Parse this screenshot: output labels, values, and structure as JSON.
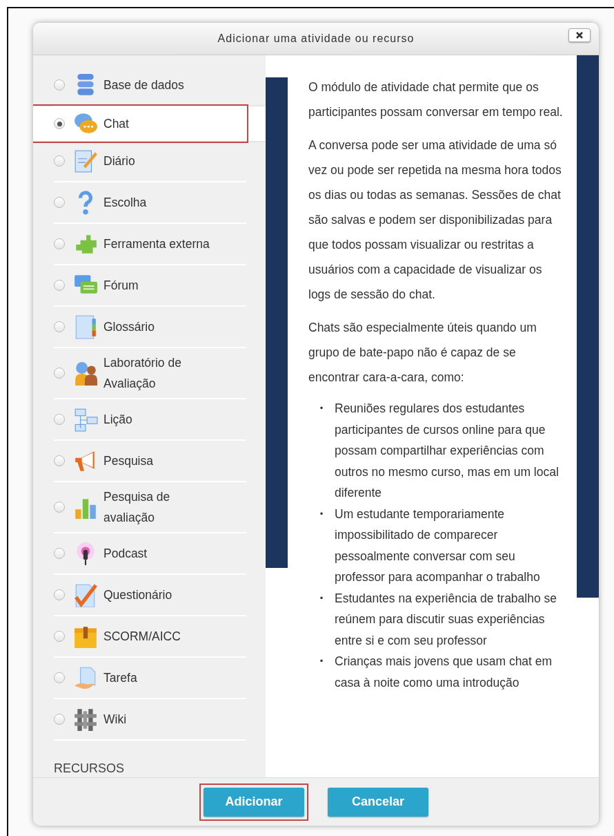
{
  "dialog": {
    "title": "Adicionar uma atividade ou recurso"
  },
  "activities": [
    {
      "label": "Base de dados",
      "selected": false
    },
    {
      "label": "Chat",
      "selected": true
    },
    {
      "label": "Diário",
      "selected": false
    },
    {
      "label": "Escolha",
      "selected": false
    },
    {
      "label": "Ferramenta externa",
      "selected": false
    },
    {
      "label": "Fórum",
      "selected": false
    },
    {
      "label": "Glossário",
      "selected": false
    },
    {
      "label": "Laboratório de Avaliação",
      "selected": false
    },
    {
      "label": "Lição",
      "selected": false
    },
    {
      "label": "Pesquisa",
      "selected": false
    },
    {
      "label": "Pesquisa de avaliação",
      "selected": false
    },
    {
      "label": "Podcast",
      "selected": false
    },
    {
      "label": "Questionário",
      "selected": false
    },
    {
      "label": "SCORM/AICC",
      "selected": false
    },
    {
      "label": "Tarefa",
      "selected": false
    },
    {
      "label": "Wiki",
      "selected": false
    }
  ],
  "section_heading": "RECURSOS",
  "description": {
    "paragraphs": [
      "O módulo de atividade chat permite que os participantes possam conversar em tempo real.",
      "A conversa pode ser uma atividade de uma só vez ou pode ser repetida na mesma hora todos os dias ou todas as semanas. Sessões de chat são salvas e podem ser disponibilizadas para que todos possam visualizar ou restritas a usuários com a capacidade de visualizar os logs de sessão do chat.",
      "Chats são especialmente úteis quando um grupo de bate-papo não é capaz de se encontrar cara-a-cara, como:"
    ],
    "bullets": [
      {
        "marker": "•",
        "text": "Reuniões regulares dos estudantes participantes de cursos online para que possam compartilhar experiências com outros no mesmo curso, mas em um local diferente"
      },
      {
        "marker": "•",
        "text": "Um estudante temporariamente impossibilitado de comparecer pessoalmente conversar com seu professor para acompanhar o trabalho"
      },
      {
        "marker": "•",
        "text": "Estudantes na experiência de trabalho se reúnem para discutir suas experiências entre si e com seu professor"
      },
      {
        "marker": "•",
        "text": "Crianças mais jovens que usam chat em casa à noite como uma introdução"
      }
    ]
  },
  "buttons": [
    {
      "label": "Adicionar",
      "highlighted": true
    },
    {
      "label": "Cancelar",
      "highlighted": false
    }
  ]
}
